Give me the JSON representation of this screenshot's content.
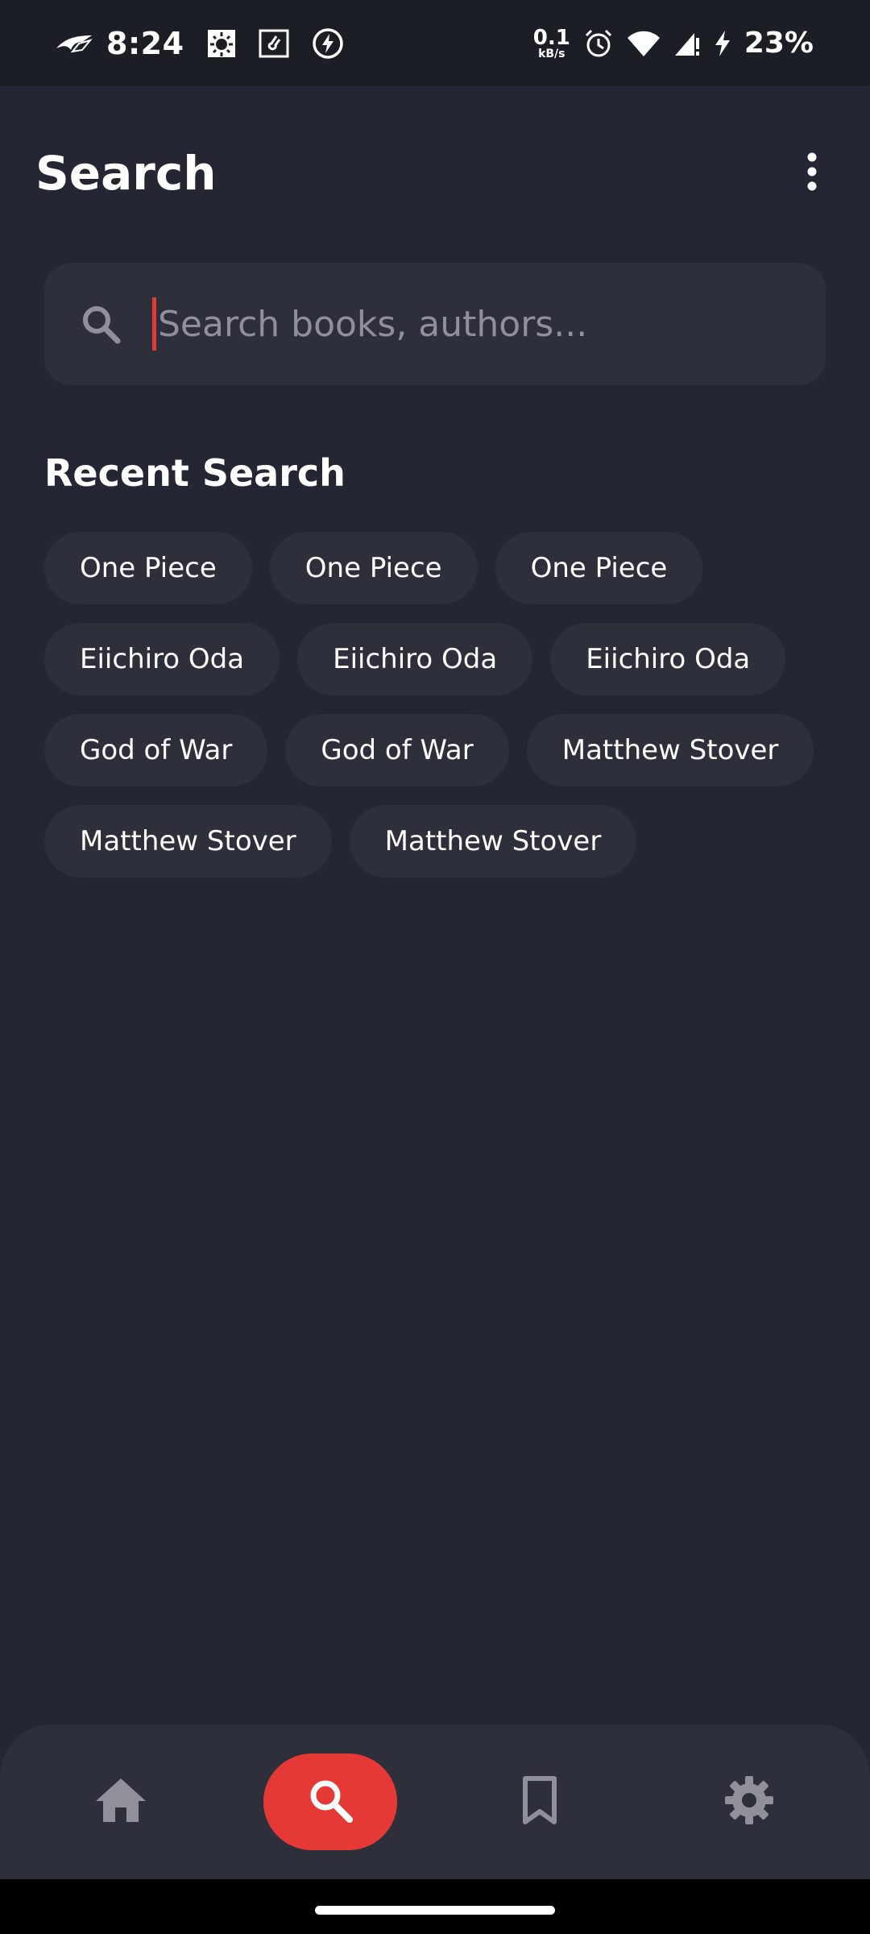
{
  "status_bar": {
    "time": "8:24",
    "net_speed_value": "0.1",
    "net_speed_unit": "kB/s",
    "battery": "23%",
    "icons": [
      "rog-logo-icon",
      "sun-notification-icon",
      "music-notification-icon",
      "flash-notification-icon",
      "alarm-icon",
      "wifi-icon",
      "signal-icon",
      "charging-icon"
    ]
  },
  "header": {
    "title": "Search",
    "menu_icon": "more-vertical-icon"
  },
  "search": {
    "placeholder": "Search books, authors...",
    "value": "",
    "icon": "search-icon"
  },
  "recent": {
    "title": "Recent Search",
    "items": [
      "One Piece",
      "One Piece",
      "One Piece",
      "Eiichiro Oda",
      "Eiichiro Oda",
      "Eiichiro Oda",
      "God of War",
      "God of War",
      "Matthew Stover",
      "Matthew Stover",
      "Matthew Stover"
    ]
  },
  "bottom_nav": {
    "items": [
      {
        "icon": "home-icon",
        "active": false
      },
      {
        "icon": "search-icon",
        "active": true
      },
      {
        "icon": "bookmark-icon",
        "active": false
      },
      {
        "icon": "settings-icon",
        "active": false
      }
    ]
  },
  "colors": {
    "background": "#242633",
    "surface": "#2d2f3b",
    "accent": "#e53935",
    "muted_icon": "#8f909a"
  }
}
